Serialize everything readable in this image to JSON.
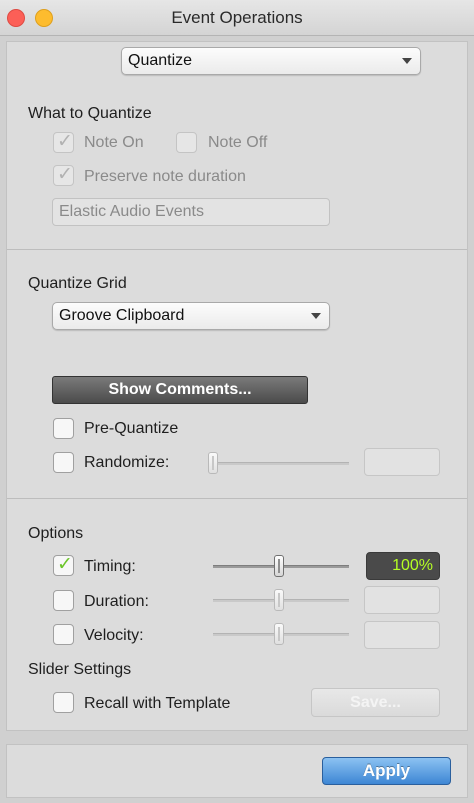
{
  "window": {
    "title": "Event Operations"
  },
  "operation": {
    "selected": "Quantize"
  },
  "what_to_quantize": {
    "heading": "What to Quantize",
    "note_on": {
      "label": "Note On",
      "checked": true,
      "enabled": false
    },
    "note_off": {
      "label": "Note Off",
      "checked": false,
      "enabled": false
    },
    "preserve_duration": {
      "label": "Preserve note duration",
      "checked": true,
      "enabled": false
    },
    "elastic_audio": "Elastic Audio Events"
  },
  "quantize_grid": {
    "heading": "Quantize Grid",
    "selected": "Groove Clipboard",
    "show_comments_label": "Show Comments...",
    "pre_quantize": {
      "label": "Pre-Quantize",
      "checked": false
    },
    "randomize": {
      "label": "Randomize:",
      "checked": false,
      "value": ""
    }
  },
  "options": {
    "heading": "Options",
    "timing": {
      "label": "Timing:",
      "checked": true,
      "value": "100%"
    },
    "duration": {
      "label": "Duration:",
      "checked": false,
      "value": ""
    },
    "velocity": {
      "label": "Velocity:",
      "checked": false,
      "value": ""
    }
  },
  "slider_settings": {
    "heading": "Slider Settings",
    "recall_with_template": {
      "label": "Recall with Template",
      "checked": false
    },
    "save_label": "Save..."
  },
  "footer": {
    "apply_label": "Apply"
  },
  "colors": {
    "accent_blue": "#3d86d4",
    "check_green": "#6cc52a",
    "value_green": "#b5ff24",
    "close_red": "#fc5f57",
    "minimize_yellow": "#fdbc2e"
  },
  "icons": {
    "close": "close-icon",
    "minimize": "minimize-icon",
    "popup_arrow": "chevron-down-icon",
    "check": "checkmark-icon"
  }
}
